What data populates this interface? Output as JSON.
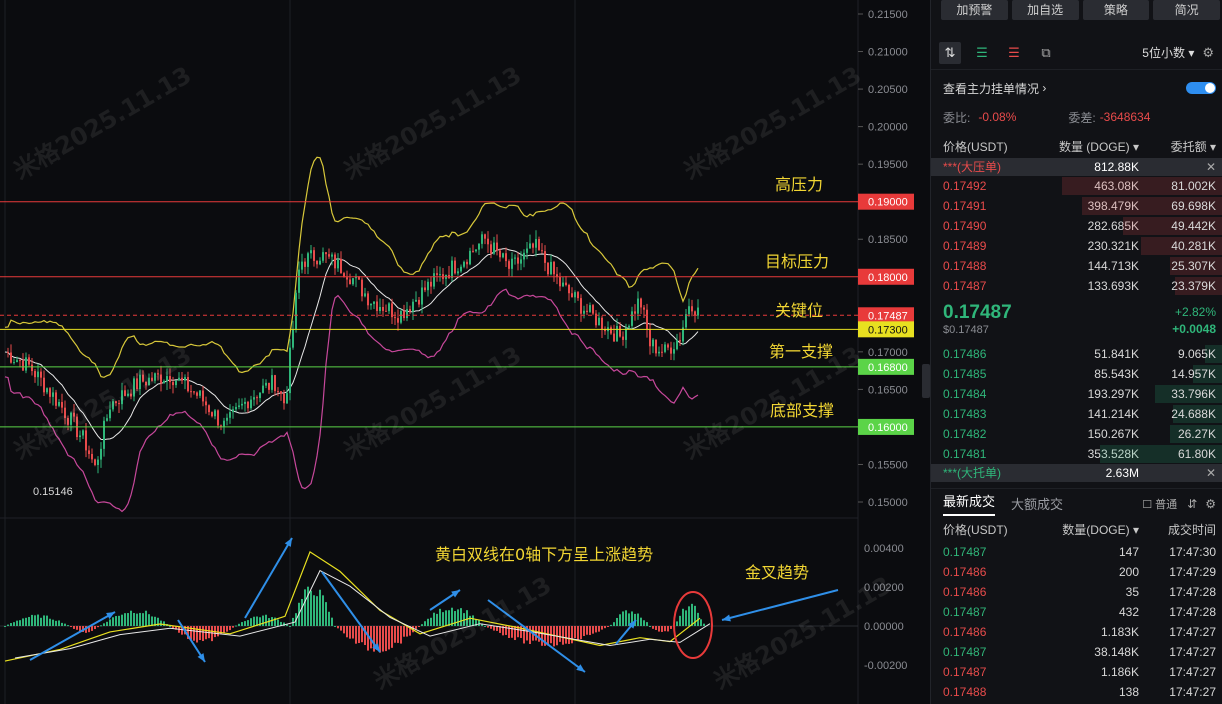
{
  "chart_data": {
    "type": "candlestick",
    "price_axis": {
      "ticks": [
        "0.21500",
        "0.21000",
        "0.20500",
        "0.20000",
        "0.19500",
        "0.19000",
        "0.18500",
        "0.18000",
        "0.17500",
        "0.17000",
        "0.16500",
        "0.16000",
        "0.15500",
        "0.15000"
      ],
      "range": [
        0.1485,
        0.2155
      ]
    },
    "indicator_axis": {
      "ticks": [
        "0.00400",
        "0.00200",
        "0.00000",
        "-0.00200"
      ],
      "range": [
        -0.0032,
        0.005
      ]
    },
    "current_price_label": "0.17487",
    "low_label": "0.15146",
    "price_levels": [
      {
        "label": "高压力",
        "price": 0.19,
        "price_text": "0.19000",
        "color": "#e83a3a"
      },
      {
        "label": "目标压力",
        "price": 0.18,
        "price_text": "0.18000",
        "color": "#e83a3a"
      },
      {
        "label": "关键位",
        "price": 0.17487,
        "price_text": "0.17487",
        "color": "#e83a3a"
      },
      {
        "label": "第一支撑",
        "price": 0.173,
        "price_text": "0.17300",
        "color": "#e8e020"
      },
      {
        "label": "",
        "price": 0.168,
        "price_text": "0.16800",
        "color": "#5bd448"
      },
      {
        "label": "底部支撑",
        "price": 0.16,
        "price_text": "0.16000",
        "color": "#5bd448"
      }
    ],
    "indicator_annotations": [
      "黄白双线在0轴下方呈上涨趋势",
      "金叉趋势"
    ],
    "watermark": "米格2025.11.13"
  },
  "panel": {
    "buttons": [
      "加预警",
      "加自选",
      "策略",
      "简况"
    ],
    "decimals": "5位小数",
    "order_toggle_label": "查看主力挂单情况",
    "weibi_label": "委比:",
    "weibi_value": "-0.08%",
    "weicha_label": "委差:",
    "weicha_value": "-3648634",
    "ob_headers": [
      "价格(USDT)",
      "数量 (DOGE)",
      "委托额"
    ],
    "big_ask_label": "***(大压单)",
    "big_ask_value": "812.88K",
    "asks": [
      {
        "price": "0.17492",
        "qty": "463.08K",
        "amount": "81.002K",
        "fill": 0.55
      },
      {
        "price": "0.17491",
        "qty": "398.479K",
        "amount": "69.698K",
        "fill": 0.48
      },
      {
        "price": "0.17490",
        "qty": "282.685K",
        "amount": "49.442K",
        "fill": 0.34
      },
      {
        "price": "0.17489",
        "qty": "230.321K",
        "amount": "40.281K",
        "fill": 0.28
      },
      {
        "price": "0.17488",
        "qty": "144.713K",
        "amount": "25.307K",
        "fill": 0.18
      },
      {
        "price": "0.17487",
        "qty": "133.693K",
        "amount": "23.379K",
        "fill": 0.16
      }
    ],
    "mid_price": "0.17487",
    "mid_price_usd": "$0.17487",
    "mid_change_pct": "+2.82%",
    "mid_change": "+0.0048",
    "bids": [
      {
        "price": "0.17486",
        "qty": "51.841K",
        "amount": "9.065K",
        "fill": 0.06
      },
      {
        "price": "0.17485",
        "qty": "85.543K",
        "amount": "14.957K",
        "fill": 0.1
      },
      {
        "price": "0.17484",
        "qty": "193.297K",
        "amount": "33.796K",
        "fill": 0.23
      },
      {
        "price": "0.17483",
        "qty": "141.214K",
        "amount": "24.688K",
        "fill": 0.17
      },
      {
        "price": "0.17482",
        "qty": "150.267K",
        "amount": "26.27K",
        "fill": 0.18
      },
      {
        "price": "0.17481",
        "qty": "353.528K",
        "amount": "61.80K",
        "fill": 0.42
      }
    ],
    "big_bid_label": "***(大托单)",
    "big_bid_value": "2.63M",
    "trade_tabs": [
      "最新成交",
      "大额成交"
    ],
    "normal_label": "普通",
    "trade_headers": [
      "价格(USDT)",
      "数量(DOGE)",
      "成交时间"
    ],
    "trades": [
      {
        "price": "0.17487",
        "qty": "147",
        "time": "17:47:30",
        "side": "buy"
      },
      {
        "price": "0.17486",
        "qty": "200",
        "time": "17:47:29",
        "side": "sell"
      },
      {
        "price": "0.17486",
        "qty": "35",
        "time": "17:47:28",
        "side": "sell"
      },
      {
        "price": "0.17487",
        "qty": "432",
        "time": "17:47:28",
        "side": "buy"
      },
      {
        "price": "0.17486",
        "qty": "1.183K",
        "time": "17:47:27",
        "side": "sell"
      },
      {
        "price": "0.17487",
        "qty": "38.148K",
        "time": "17:47:27",
        "side": "buy"
      },
      {
        "price": "0.17487",
        "qty": "1.186K",
        "time": "17:47:27",
        "side": "sell"
      },
      {
        "price": "0.17488",
        "qty": "138",
        "time": "17:47:27",
        "side": "sell"
      }
    ]
  }
}
